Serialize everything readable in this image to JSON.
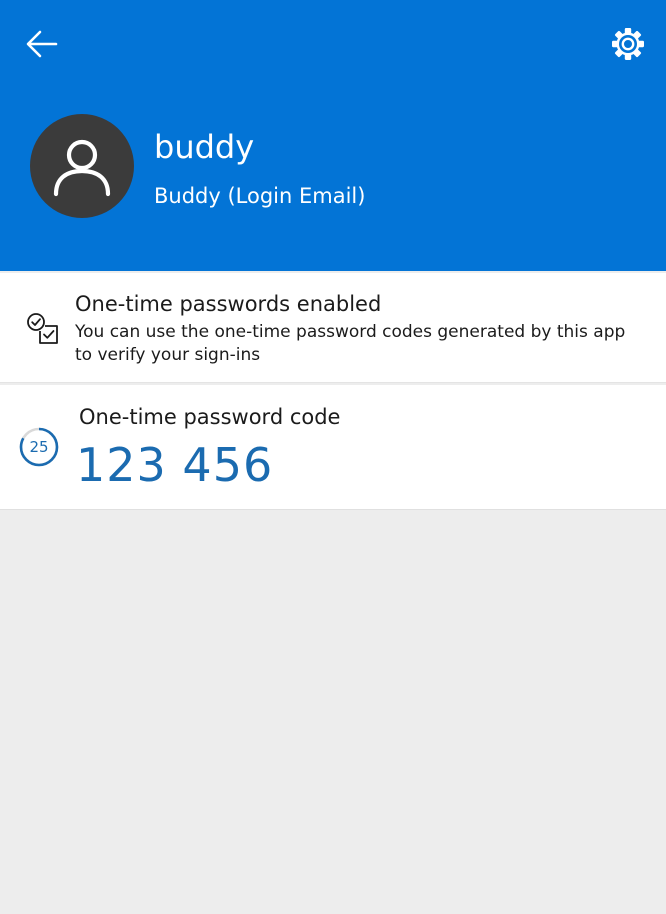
{
  "header": {
    "username": "buddy",
    "account_label": "Buddy (Login Email)"
  },
  "otp_status": {
    "title": "One-time passwords enabled",
    "description": "You can use the one-time password codes generated by this app to verify your sign-ins"
  },
  "otp_code": {
    "label": "One-time password code",
    "code": "123 456",
    "seconds_remaining": "25",
    "timer_fraction_remaining": 0.83
  },
  "icons": {
    "back": "back-arrow-icon",
    "settings": "gear-icon",
    "avatar": "person-icon",
    "status": "checklist-icon"
  },
  "colors": {
    "header_bg": "#0374d6",
    "accent": "#1b6bb0",
    "avatar_bg": "#3b3b3b",
    "page_bg": "#ededed"
  }
}
